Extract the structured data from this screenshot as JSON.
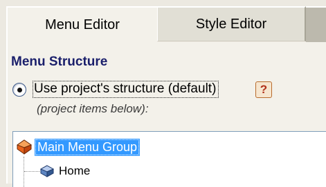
{
  "tabs": [
    {
      "label": "Menu Editor",
      "active": true
    },
    {
      "label": "Style Editor",
      "active": false
    }
  ],
  "section": {
    "title": "Menu Structure"
  },
  "structure_option": {
    "label": "Use project's structure (default)",
    "selected": true,
    "note": "(project items below):"
  },
  "help": {
    "label": "?",
    "icon": "help-icon"
  },
  "tree": {
    "root": {
      "label": "Main Menu Group",
      "icon": "menu-group-icon",
      "selected": true
    },
    "children": [
      {
        "label": "Home",
        "icon": "menu-item-icon"
      }
    ]
  },
  "colors": {
    "panel": "#f3f1ea",
    "title": "#1a1f6b",
    "selection": "#3399ff",
    "help_border": "#b86a2a"
  }
}
